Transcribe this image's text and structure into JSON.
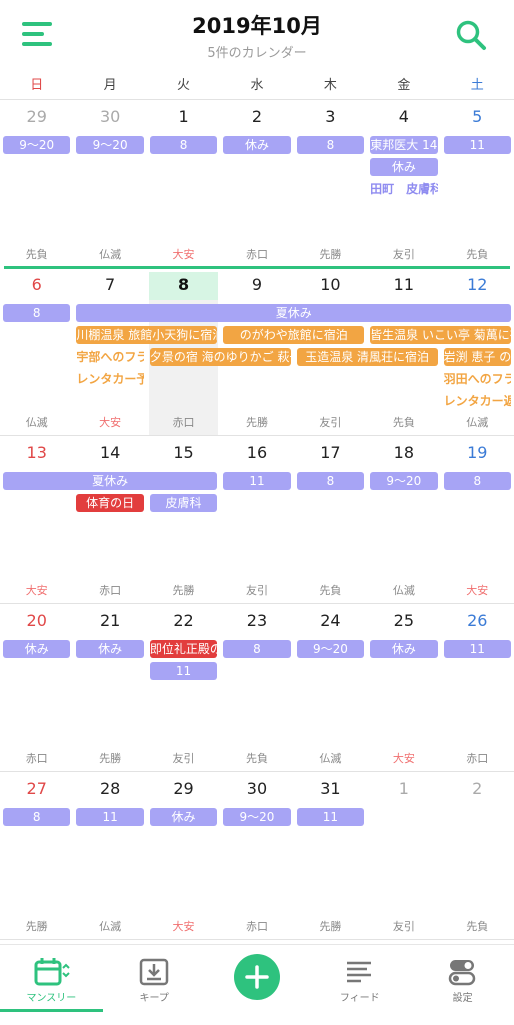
{
  "header": {
    "title": "2019年10月",
    "subtitle": "5件のカレンダー"
  },
  "weekdays": [
    "日",
    "月",
    "火",
    "水",
    "木",
    "金",
    "土"
  ],
  "colors": {
    "accent": "#2ec27e",
    "sunday": "#e04848",
    "saturday": "#3b7bd6",
    "muted": "#aaaaaa",
    "event_purple": "#a7a4f5",
    "event_orange": "#f2a543",
    "event_red": "#e23d3d"
  },
  "weeks": [
    {
      "days": [
        "29",
        "30",
        "1",
        "2",
        "3",
        "4",
        "5"
      ],
      "muted": [
        true,
        true,
        false,
        false,
        false,
        false,
        false
      ],
      "rokuyo": [
        "先負",
        "仏滅",
        "大安",
        "赤口",
        "先勝",
        "友引",
        "先負"
      ]
    },
    {
      "days": [
        "6",
        "7",
        "8",
        "9",
        "10",
        "11",
        "12"
      ],
      "muted": [
        false,
        false,
        false,
        false,
        false,
        false,
        false
      ],
      "rokuyo": [
        "仏滅",
        "大安",
        "赤口",
        "先勝",
        "友引",
        "先負",
        "仏滅"
      ]
    },
    {
      "days": [
        "13",
        "14",
        "15",
        "16",
        "17",
        "18",
        "19"
      ],
      "muted": [
        false,
        false,
        false,
        false,
        false,
        false,
        false
      ],
      "rokuyo": [
        "大安",
        "赤口",
        "先勝",
        "友引",
        "先負",
        "仏滅",
        "大安"
      ]
    },
    {
      "days": [
        "20",
        "21",
        "22",
        "23",
        "24",
        "25",
        "26"
      ],
      "muted": [
        false,
        false,
        false,
        false,
        false,
        false,
        false
      ],
      "rokuyo": [
        "赤口",
        "先勝",
        "友引",
        "先負",
        "仏滅",
        "大安",
        "赤口"
      ]
    },
    {
      "days": [
        "27",
        "28",
        "29",
        "30",
        "31",
        "1",
        "2"
      ],
      "muted": [
        false,
        false,
        false,
        false,
        false,
        true,
        true
      ],
      "rokuyo": [
        "先勝",
        "仏滅",
        "大安",
        "赤口",
        "先勝",
        "友引",
        "先負"
      ]
    }
  ],
  "today": {
    "week": 1,
    "col": 2
  },
  "events": [
    {
      "w": 0,
      "c": 0,
      "span": 1,
      "row": 0,
      "text": "9〜20",
      "style": "purple"
    },
    {
      "w": 0,
      "c": 1,
      "span": 1,
      "row": 0,
      "text": "9〜20",
      "style": "purple"
    },
    {
      "w": 0,
      "c": 2,
      "span": 1,
      "row": 0,
      "text": "8",
      "style": "purple"
    },
    {
      "w": 0,
      "c": 3,
      "span": 1,
      "row": 0,
      "text": "休み",
      "style": "purple"
    },
    {
      "w": 0,
      "c": 4,
      "span": 1,
      "row": 0,
      "text": "8",
      "style": "purple"
    },
    {
      "w": 0,
      "c": 5,
      "span": 1,
      "row": 0,
      "text": "東邦医大 14",
      "style": "purple"
    },
    {
      "w": 0,
      "c": 6,
      "span": 1,
      "row": 0,
      "text": "11",
      "style": "purple"
    },
    {
      "w": 0,
      "c": 5,
      "span": 1,
      "row": 1,
      "text": "休み",
      "style": "purple"
    },
    {
      "w": 0,
      "c": 5,
      "span": 1,
      "row": 2,
      "text": "田町　皮膚科",
      "style": "text-purple"
    },
    {
      "w": 1,
      "c": 0,
      "span": 1,
      "row": 0,
      "text": "8",
      "style": "purple"
    },
    {
      "w": 1,
      "c": 1,
      "span": 6,
      "row": 0,
      "text": "夏休み",
      "style": "purple"
    },
    {
      "w": 1,
      "c": 1,
      "span": 2,
      "row": 1,
      "text": "川棚温泉 旅館小天狗に宿泊",
      "style": "orange"
    },
    {
      "w": 1,
      "c": 3,
      "span": 2,
      "row": 1,
      "text": "のがわや旅館に宿泊",
      "style": "orange"
    },
    {
      "w": 1,
      "c": 5,
      "span": 2,
      "row": 1,
      "text": "皆生温泉 いこい亭 菊萬に宿泊",
      "style": "orange"
    },
    {
      "w": 1,
      "c": 1,
      "span": 1,
      "row": 2,
      "text": "宇部へのフライト",
      "style": "text-orange"
    },
    {
      "w": 1,
      "c": 2,
      "span": 2,
      "row": 2,
      "text": "夕景の宿 海のゆりかご 萩一輪",
      "style": "orange"
    },
    {
      "w": 1,
      "c": 4,
      "span": 2,
      "row": 2,
      "text": "玉造温泉 清風荘に宿泊",
      "style": "orange"
    },
    {
      "w": 1,
      "c": 6,
      "span": 1,
      "row": 2,
      "text": "岩渕 恵子 の誕生日",
      "style": "orange"
    },
    {
      "w": 1,
      "c": 1,
      "span": 1,
      "row": 3,
      "text": "レンタカー予約",
      "style": "text-orange"
    },
    {
      "w": 1,
      "c": 6,
      "span": 1,
      "row": 3,
      "text": "羽田へのフライト",
      "style": "text-orange"
    },
    {
      "w": 1,
      "c": 6,
      "span": 1,
      "row": 4,
      "text": "レンタカー返却",
      "style": "text-orange"
    },
    {
      "w": 2,
      "c": 0,
      "span": 3,
      "row": 0,
      "text": "夏休み",
      "style": "purple"
    },
    {
      "w": 2,
      "c": 3,
      "span": 1,
      "row": 0,
      "text": "11",
      "style": "purple"
    },
    {
      "w": 2,
      "c": 4,
      "span": 1,
      "row": 0,
      "text": "8",
      "style": "purple"
    },
    {
      "w": 2,
      "c": 5,
      "span": 1,
      "row": 0,
      "text": "9〜20",
      "style": "purple"
    },
    {
      "w": 2,
      "c": 6,
      "span": 1,
      "row": 0,
      "text": "8",
      "style": "purple"
    },
    {
      "w": 2,
      "c": 1,
      "span": 1,
      "row": 1,
      "text": "体育の日",
      "style": "red"
    },
    {
      "w": 2,
      "c": 2,
      "span": 1,
      "row": 1,
      "text": "皮膚科",
      "style": "purple"
    },
    {
      "w": 3,
      "c": 0,
      "span": 1,
      "row": 0,
      "text": "休み",
      "style": "purple"
    },
    {
      "w": 3,
      "c": 1,
      "span": 1,
      "row": 0,
      "text": "休み",
      "style": "purple"
    },
    {
      "w": 3,
      "c": 2,
      "span": 1,
      "row": 0,
      "text": "即位礼正殿の儀",
      "style": "red"
    },
    {
      "w": 3,
      "c": 3,
      "span": 1,
      "row": 0,
      "text": "8",
      "style": "purple"
    },
    {
      "w": 3,
      "c": 4,
      "span": 1,
      "row": 0,
      "text": "9〜20",
      "style": "purple"
    },
    {
      "w": 3,
      "c": 5,
      "span": 1,
      "row": 0,
      "text": "休み",
      "style": "purple"
    },
    {
      "w": 3,
      "c": 6,
      "span": 1,
      "row": 0,
      "text": "11",
      "style": "purple"
    },
    {
      "w": 3,
      "c": 2,
      "span": 1,
      "row": 1,
      "text": "11",
      "style": "purple"
    },
    {
      "w": 4,
      "c": 0,
      "span": 1,
      "row": 0,
      "text": "8",
      "style": "purple"
    },
    {
      "w": 4,
      "c": 1,
      "span": 1,
      "row": 0,
      "text": "11",
      "style": "purple"
    },
    {
      "w": 4,
      "c": 2,
      "span": 1,
      "row": 0,
      "text": "休み",
      "style": "purple"
    },
    {
      "w": 4,
      "c": 3,
      "span": 1,
      "row": 0,
      "text": "9〜20",
      "style": "purple"
    },
    {
      "w": 4,
      "c": 4,
      "span": 1,
      "row": 0,
      "text": "11",
      "style": "purple"
    }
  ],
  "tabbar": {
    "tabs": [
      {
        "label": "マンスリー",
        "icon": "calendar-icon",
        "active": true
      },
      {
        "label": "キープ",
        "icon": "download-tray-icon",
        "active": false
      },
      {
        "label": "",
        "icon": "plus-icon",
        "active": false
      },
      {
        "label": "フィード",
        "icon": "feed-lines-icon",
        "active": false
      },
      {
        "label": "設定",
        "icon": "toggle-switches-icon",
        "active": false
      }
    ]
  }
}
